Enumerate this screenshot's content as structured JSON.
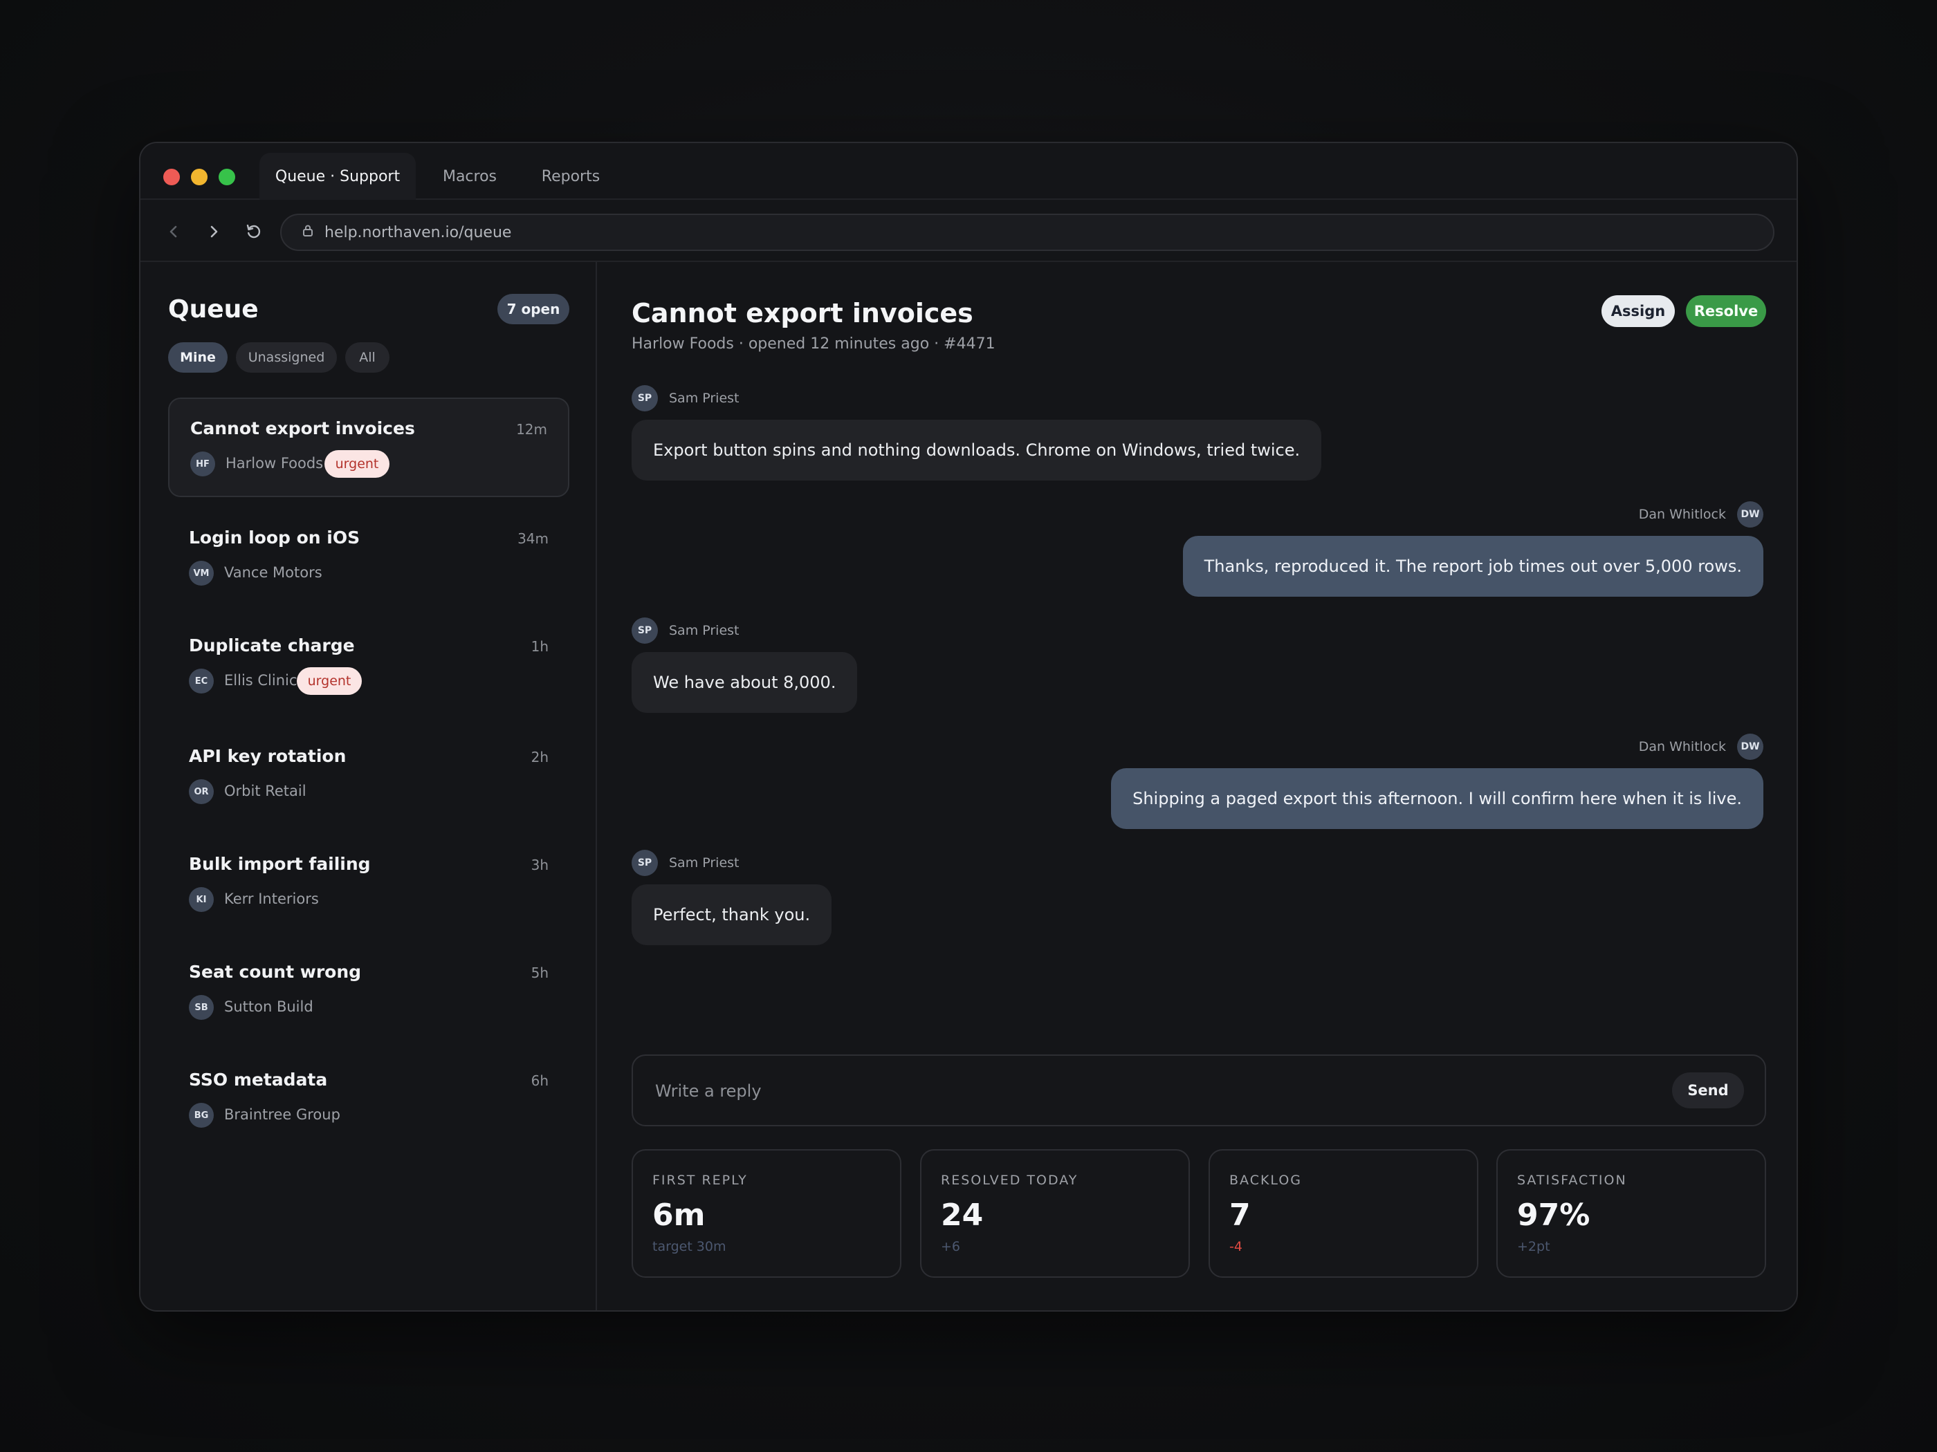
{
  "tabs": [
    {
      "label": "Queue · Support"
    },
    {
      "label": "Macros"
    },
    {
      "label": "Reports"
    }
  ],
  "address": {
    "url": "help.northaven.io/queue"
  },
  "sidebar": {
    "title": "Queue",
    "open_count": "7 open",
    "filters": [
      {
        "label": "Mine",
        "active": true
      },
      {
        "label": "Unassigned",
        "active": false
      },
      {
        "label": "All",
        "active": false
      }
    ],
    "tickets": [
      {
        "title": "Cannot export invoices",
        "time": "12m",
        "initials": "HF",
        "company": "Harlow Foods",
        "badge": "urgent"
      },
      {
        "title": "Login loop on iOS",
        "time": "34m",
        "initials": "VM",
        "company": "Vance Motors",
        "badge": ""
      },
      {
        "title": "Duplicate charge",
        "time": "1h",
        "initials": "EC",
        "company": "Ellis Clinic",
        "badge": "urgent"
      },
      {
        "title": "API key rotation",
        "time": "2h",
        "initials": "OR",
        "company": "Orbit Retail",
        "badge": ""
      },
      {
        "title": "Bulk import failing",
        "time": "3h",
        "initials": "KI",
        "company": "Kerr Interiors",
        "badge": ""
      },
      {
        "title": "Seat count wrong",
        "time": "5h",
        "initials": "SB",
        "company": "Sutton Build",
        "badge": ""
      },
      {
        "title": "SSO metadata",
        "time": "6h",
        "initials": "BG",
        "company": "Braintree Group",
        "badge": ""
      }
    ]
  },
  "conversation": {
    "title": "Cannot export invoices",
    "subtitle": "Harlow Foods · opened 12 minutes ago · #4471",
    "assign_label": "Assign",
    "resolve_label": "Resolve",
    "messages": [
      {
        "initials": "SP",
        "sender": "Sam Priest",
        "text": "Export button spins and nothing downloads. Chrome on Windows, tried twice.",
        "direction": "in"
      },
      {
        "initials": "DW",
        "sender": "Dan Whitlock",
        "text": "Thanks, reproduced it. The report job times out over 5,000 rows.",
        "direction": "out"
      },
      {
        "initials": "SP",
        "sender": "Sam Priest",
        "text": "We have about 8,000.",
        "direction": "in"
      },
      {
        "initials": "DW",
        "sender": "Dan Whitlock",
        "text": "Shipping a paged export this afternoon. I will confirm here when it is live.",
        "direction": "out"
      },
      {
        "initials": "SP",
        "sender": "Sam Priest",
        "text": "Perfect, thank you.",
        "direction": "in"
      }
    ],
    "reply": {
      "placeholder": "Write a reply",
      "value": "",
      "send_label": "Send"
    }
  },
  "stats": [
    {
      "label": "FIRST REPLY",
      "value": "6m",
      "delta": "target 30m",
      "tone": "neutral"
    },
    {
      "label": "RESOLVED TODAY",
      "value": "24",
      "delta": "+6",
      "tone": "neutral"
    },
    {
      "label": "BACKLOG",
      "value": "7",
      "delta": "-4",
      "tone": "negative"
    },
    {
      "label": "SATISFACTION",
      "value": "97%",
      "delta": "+2pt",
      "tone": "neutral"
    }
  ],
  "colors": {
    "accent": "#3d4656",
    "resolve": "#3a9a47",
    "urgent_bg": "#fbe5e4",
    "urgent_text": "#b3322b",
    "negative": "#e04a42"
  }
}
